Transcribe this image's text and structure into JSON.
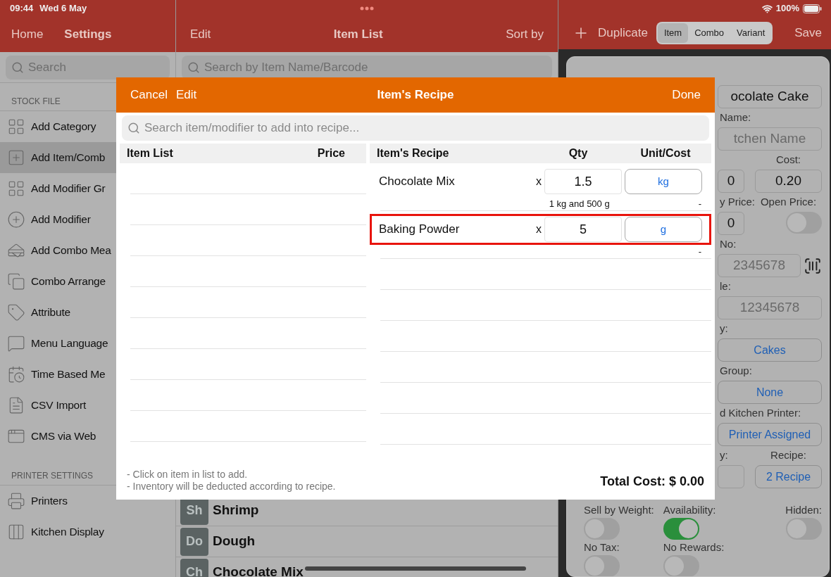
{
  "status_bar": {
    "time": "09:44",
    "date": "Wed 6 May",
    "battery": "100%"
  },
  "sidebar": {
    "home": "Home",
    "title": "Settings",
    "search_placeholder": "Search",
    "sections": [
      {
        "title": "STOCK FILE",
        "items": [
          {
            "label": "Add Category",
            "selected": false
          },
          {
            "label": "Add Item/Comb",
            "selected": true
          },
          {
            "label": "Add Modifier Gr",
            "selected": false
          },
          {
            "label": "Add Modifier",
            "selected": false
          },
          {
            "label": "Add Combo Mea",
            "selected": false
          },
          {
            "label": "Combo Arrange",
            "selected": false
          },
          {
            "label": "Attribute",
            "selected": false
          },
          {
            "label": "Menu Language",
            "selected": false
          },
          {
            "label": "Time Based Me",
            "selected": false
          },
          {
            "label": "CSV Import",
            "selected": false
          },
          {
            "label": "CMS via Web",
            "selected": false
          }
        ]
      },
      {
        "title": "PRINTER SETTINGS",
        "items": [
          {
            "label": "Printers",
            "selected": false
          },
          {
            "label": "Kitchen Display",
            "selected": false
          }
        ]
      }
    ]
  },
  "item_list": {
    "edit": "Edit",
    "title": "Item List",
    "sort": "Sort by",
    "search_placeholder": "Search by Item Name/Barcode",
    "rows": [
      {
        "badge": "Sh",
        "name": "Shrimp"
      },
      {
        "badge": "Do",
        "name": "Dough"
      },
      {
        "badge": "Ch",
        "name": "Chocolate Mix"
      }
    ]
  },
  "item_form": {
    "duplicate": "Duplicate",
    "segments": [
      {
        "label": "Item",
        "selected": true
      },
      {
        "label": "Combo",
        "selected": false
      },
      {
        "label": "Variant",
        "selected": false
      }
    ],
    "save": "Save",
    "rows": [
      {
        "kind": "field",
        "value": "ocolate Cake"
      },
      {
        "kind": "labels",
        "left": "Name:"
      },
      {
        "kind": "field",
        "placeholder": "tchen Name"
      },
      {
        "kind": "labels",
        "right": "Cost:"
      },
      {
        "kind": "pair",
        "left": {
          "kind": "field",
          "value": "0"
        },
        "right": {
          "kind": "field",
          "value": "0.20"
        }
      },
      {
        "kind": "labels",
        "left": "y Price:",
        "right": "Open Price:"
      },
      {
        "kind": "pair",
        "left": {
          "kind": "field",
          "value": "0"
        },
        "right": {
          "kind": "toggle",
          "on": false
        }
      },
      {
        "kind": "labels",
        "left": "No:"
      },
      {
        "kind": "barcode",
        "placeholder": "2345678"
      },
      {
        "kind": "labels",
        "left": "le:"
      },
      {
        "kind": "field",
        "placeholder": "12345678"
      },
      {
        "kind": "labels",
        "left": "y:"
      },
      {
        "kind": "button",
        "text": "Cakes"
      },
      {
        "kind": "labels",
        "left": "Group:"
      },
      {
        "kind": "button",
        "text": "None"
      },
      {
        "kind": "labels",
        "left": "d Kitchen Printer:"
      },
      {
        "kind": "button",
        "text": "Printer Assigned"
      },
      {
        "kind": "labels",
        "left": "y:",
        "right": "Recipe:"
      },
      {
        "kind": "pair",
        "left": {
          "kind": "field"
        },
        "right": {
          "kind": "button",
          "text": "2 Recipe"
        }
      }
    ],
    "switches": [
      {
        "label": "Sell by Weight:",
        "on": false
      },
      {
        "label": "Availability:",
        "on": true
      },
      {
        "label": "Hidden:",
        "on": false
      },
      {
        "label": "No Tax:",
        "on": false
      },
      {
        "label": "No Rewards:",
        "on": false
      }
    ]
  },
  "recipe_dialog": {
    "cancel": "Cancel",
    "edit": "Edit",
    "title": "Item's Recipe",
    "done": "Done",
    "search_placeholder": "Search item/modifier to add into recipe...",
    "item_list_columns": [
      "Item List",
      "Price"
    ],
    "recipe_columns": [
      "Item's Recipe",
      "Qty",
      "Unit/Cost"
    ],
    "recipe": [
      {
        "name": "Chocolate Mix",
        "x": "x",
        "qty": "1.5",
        "unit": "kg",
        "conversion": "1 kg and 500 g",
        "cost": "-",
        "selected": false
      },
      {
        "name": "Baking Powder",
        "x": "x",
        "qty": "5",
        "unit": "g",
        "cost": "-",
        "selected": true
      }
    ],
    "notes": [
      "- Click on item in list to add.",
      "- Inventory will be deducted according to recipe."
    ],
    "total": "Total Cost: $ 0.00"
  }
}
